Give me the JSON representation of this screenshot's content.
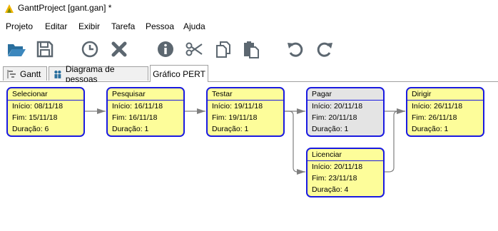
{
  "window": {
    "title": "GanttProject [gant.gan] *"
  },
  "menu": [
    "Projeto",
    "Editar",
    "Exibir",
    "Tarefa",
    "Pessoa",
    "Ajuda"
  ],
  "toolbar": {
    "buttons": [
      "folder-open-icon",
      "save-icon",
      "clock-icon",
      "delete-icon",
      "info-icon",
      "cut-icon",
      "copy-icon",
      "paste-icon",
      "undo-icon",
      "redo-icon"
    ],
    "colors": {
      "folder": "#2a6f9e",
      "icons": "#5c6770"
    }
  },
  "tabs": [
    {
      "label": "Gantt",
      "active": false
    },
    {
      "label": "Diagrama de pessoas",
      "active": false
    },
    {
      "label": "Gráfico PERT",
      "active": true
    }
  ],
  "pert": {
    "start_prefix": "Início: ",
    "end_prefix": "Fim: ",
    "duration_prefix": "Duração: ",
    "tasks": [
      {
        "name": "Selecionar",
        "start": "08/11/18",
        "end": "15/11/18",
        "duration": "6",
        "selected": false
      },
      {
        "name": "Pesquisar",
        "start": "16/11/18",
        "end": "16/11/18",
        "duration": "1",
        "selected": false
      },
      {
        "name": "Testar",
        "start": "19/11/18",
        "end": "19/11/18",
        "duration": "1",
        "selected": false
      },
      {
        "name": "Pagar",
        "start": "20/11/18",
        "end": "20/11/18",
        "duration": "1",
        "selected": true
      },
      {
        "name": "Licenciar",
        "start": "20/11/18",
        "end": "23/11/18",
        "duration": "4",
        "selected": false
      },
      {
        "name": "Dirigir",
        "start": "26/11/18",
        "end": "26/11/18",
        "duration": "1",
        "selected": false
      }
    ],
    "colors": {
      "node_fill": "#fdfd9a",
      "node_border": "#1a1ae0",
      "selected_fill": "#e4e4e4",
      "link": "#808080"
    }
  }
}
